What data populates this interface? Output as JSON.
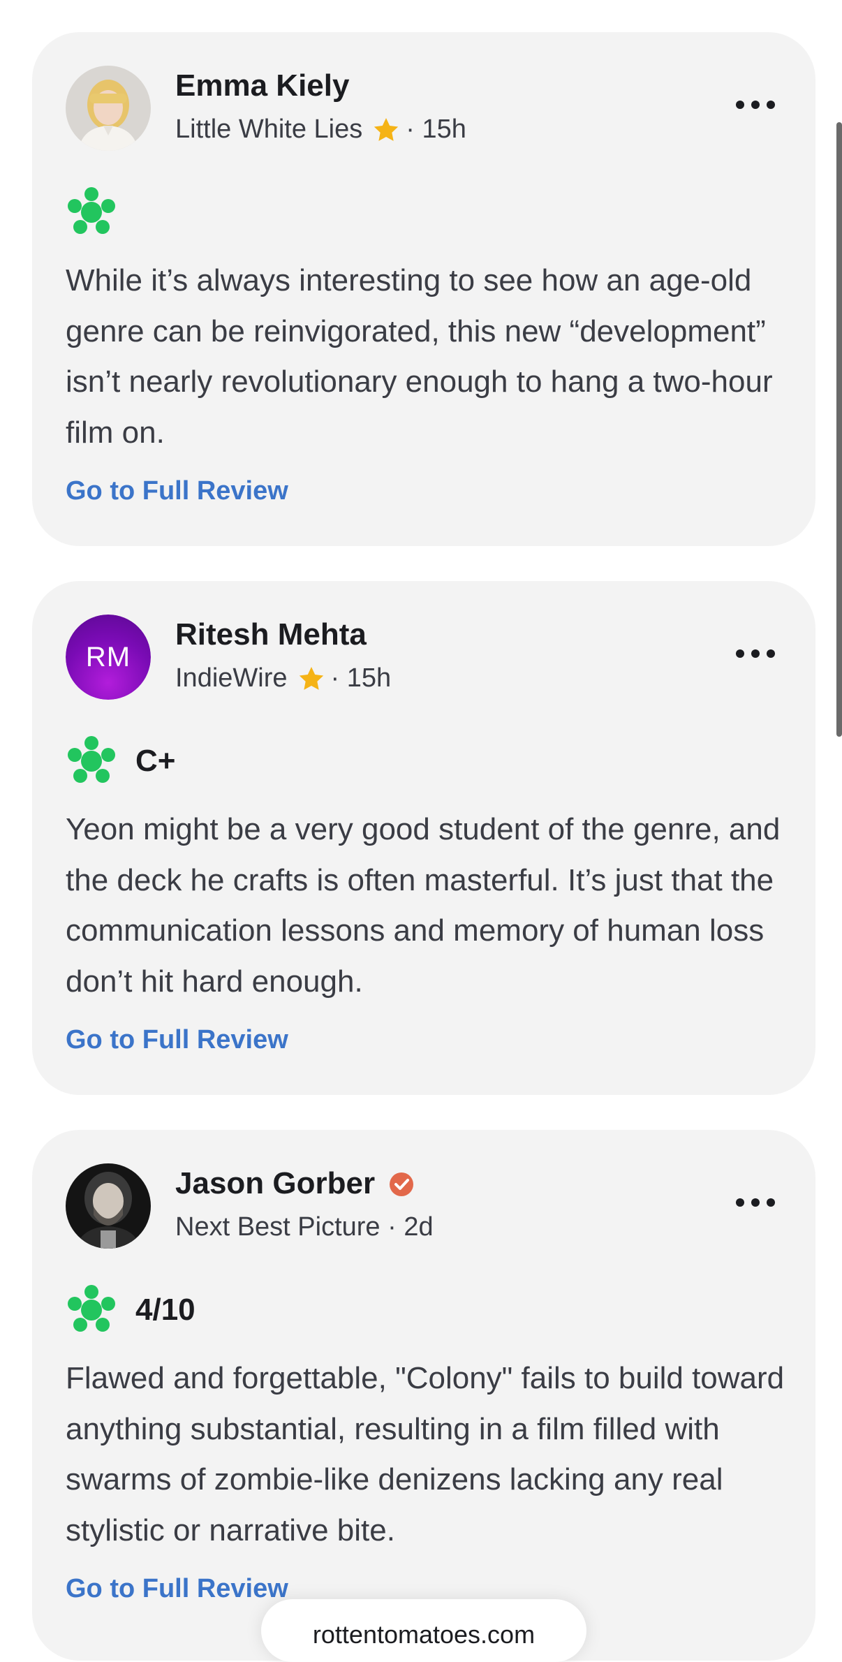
{
  "reviews": [
    {
      "critic_name": "Emma Kiely",
      "publication": "Little White Lies",
      "top_critic_icon": "star-icon",
      "verified": false,
      "time_ago": "· 15h",
      "avatar_type": "photo",
      "avatar_initials": "",
      "score_icon": "fresh-splat-icon",
      "grade": "",
      "text": "While it’s always interesting to see how an age-old genre can be reinvigorated, this new “development” isn’t nearly revolutionary enough to hang a two-hour film on.",
      "link_label": "Go to Full Review",
      "more_icon": "more-dots-icon"
    },
    {
      "critic_name": "Ritesh Mehta",
      "publication": "IndieWire",
      "top_critic_icon": "star-icon",
      "verified": false,
      "time_ago": "· 15h",
      "avatar_type": "initials",
      "avatar_initials": "RM",
      "score_icon": "fresh-splat-icon",
      "grade": "C+",
      "text": "Yeon might be a very good student of the genre, and the deck he crafts is often masterful. It’s just that the communication lessons and memory of human loss don’t hit hard enough.",
      "link_label": "Go to Full Review",
      "more_icon": "more-dots-icon"
    },
    {
      "critic_name": "Jason Gorber",
      "publication": "Next Best Picture",
      "top_critic_icon": "",
      "verified": true,
      "time_ago": "· 2d",
      "avatar_type": "photo",
      "avatar_initials": "",
      "score_icon": "fresh-splat-icon",
      "grade": "4/10",
      "text": "Flawed and forgettable, \"Colony\" fails to build toward anything substantial, resulting in a film filled with swarms of zombie-like denizens lacking any real stylistic or narrative bite.",
      "link_label": "Go to Full Review",
      "more_icon": "more-dots-icon"
    }
  ],
  "browser": {
    "url": "rottentomatoes.com"
  },
  "colors": {
    "card_background": "#f3f3f3",
    "link": "#3b74c9",
    "fresh_splat": "#22c55e",
    "star": "#f5b316",
    "verified": "#e2684a"
  }
}
